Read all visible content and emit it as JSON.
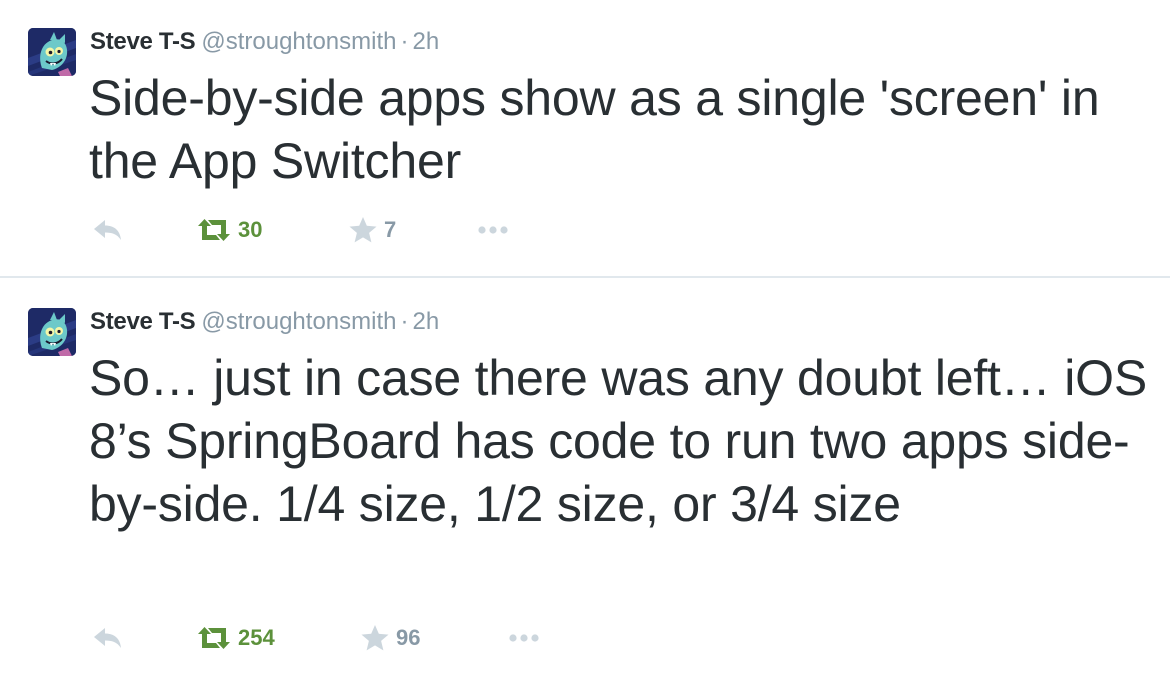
{
  "tweets": [
    {
      "author_name": "Steve T-S",
      "handle": "@stroughtonsmith",
      "separator": "·",
      "time": "2h",
      "text": "Side-by-side apps show as a single 'screen' in the App Switcher",
      "retweets": "30",
      "favorites": "7"
    },
    {
      "author_name": "Steve T-S",
      "handle": "@stroughtonsmith",
      "separator": "·",
      "time": "2h",
      "text": "So… just in case there was any doubt left… iOS 8’s SpringBoard has code to run two apps side-by-side. 1/4 size, 1/2 size, or 3/4 size",
      "retweets": "254",
      "favorites": "96"
    }
  ],
  "icons": {
    "reply": "reply-icon",
    "retweet": "retweet-icon",
    "favorite": "star-icon",
    "more": "more-icon"
  },
  "colors": {
    "text": "#292f33",
    "muted": "#8899a6",
    "retweet_green": "#5c913b",
    "icon_gray": "#ccd6dd",
    "divider": "#e1e8ed"
  }
}
